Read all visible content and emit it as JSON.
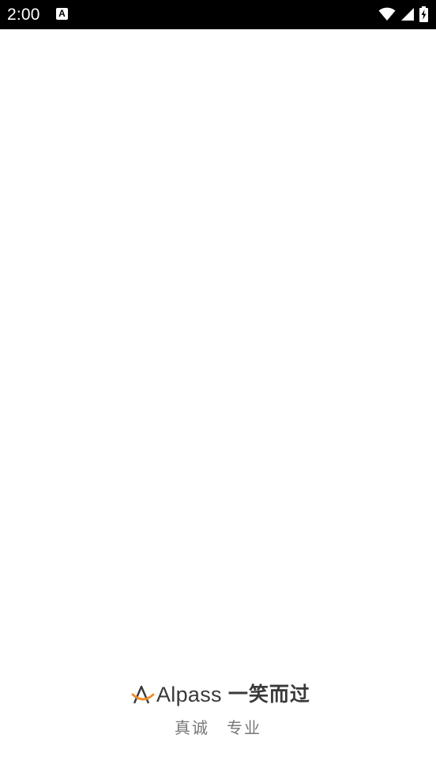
{
  "status_bar": {
    "time": "2:00",
    "notification_glyph": "A",
    "icons": [
      "wifi-icon",
      "cellular-signal-icon",
      "battery-charging-icon"
    ]
  },
  "brand": {
    "name": "Alpass",
    "tagline": "一笑而过",
    "slogan": "真诚　专业",
    "accent_color": "#F08A24",
    "text_color": "#3A3A3A",
    "slogan_color": "#777777"
  }
}
